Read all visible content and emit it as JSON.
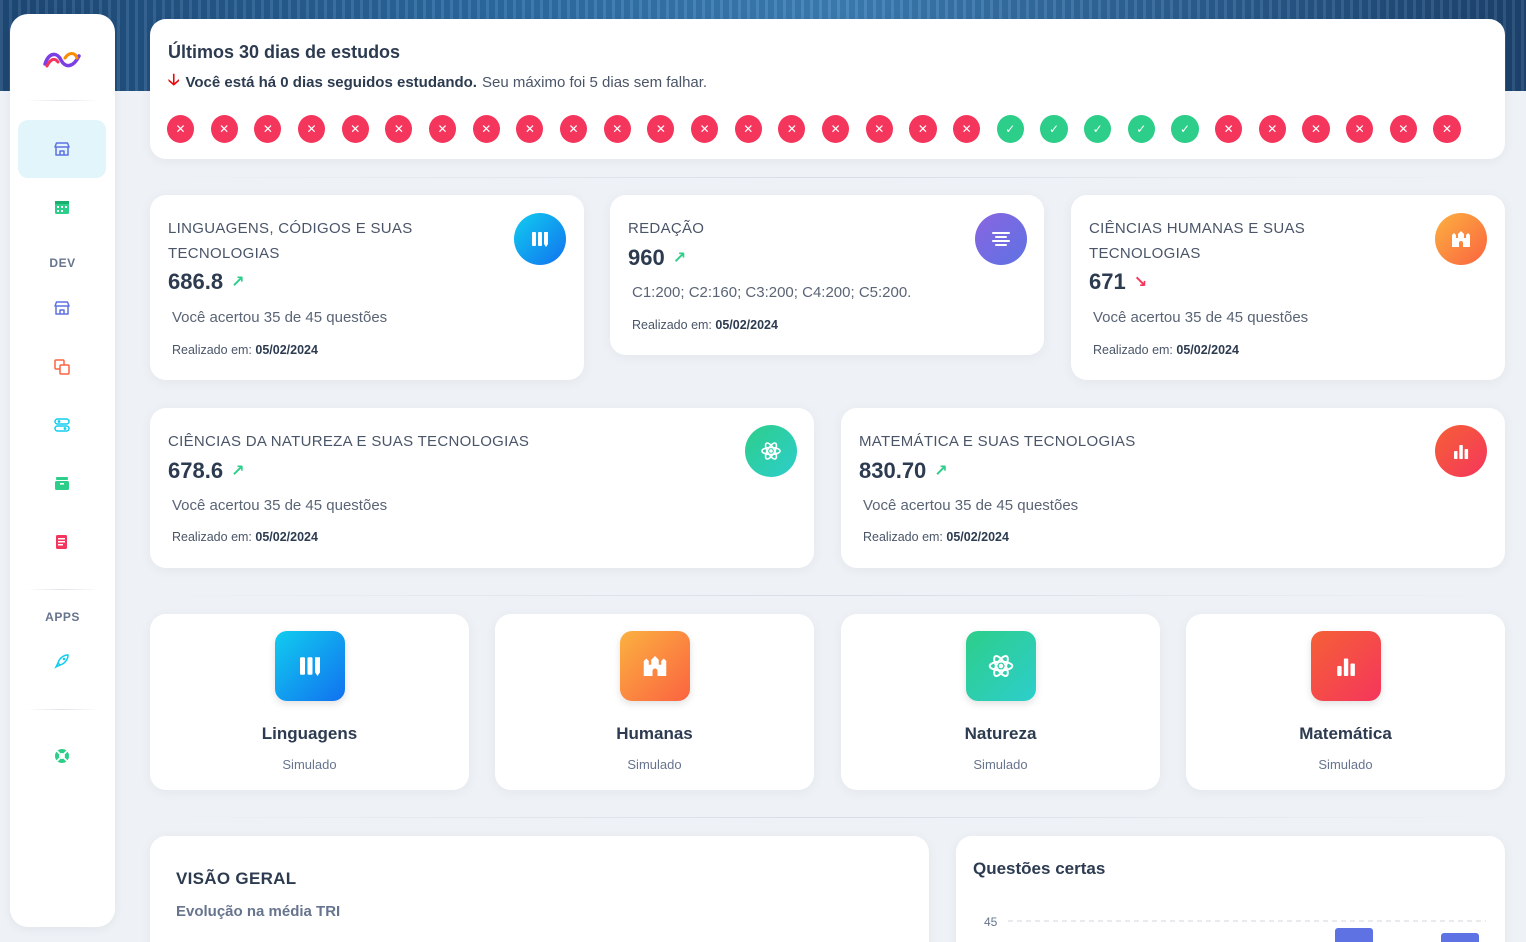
{
  "streak": {
    "title": "Últimos 30 dias de estudos",
    "status_bold": "Você está há 0 dias seguidos estudando.",
    "status_rest": "Seu máximo foi 5 dias sem falhar.",
    "days": [
      "miss",
      "miss",
      "miss",
      "miss",
      "miss",
      "miss",
      "miss",
      "miss",
      "miss",
      "miss",
      "miss",
      "miss",
      "miss",
      "miss",
      "miss",
      "miss",
      "miss",
      "miss",
      "miss",
      "hit",
      "hit",
      "hit",
      "hit",
      "hit",
      "miss",
      "miss",
      "miss",
      "miss",
      "miss",
      "miss"
    ]
  },
  "sidebar": {
    "section_dev": "DEV",
    "section_apps": "APPS"
  },
  "scores": [
    {
      "title": "LINGUAGENS, CÓDIGOS E SUAS TECNOLOGIAS",
      "score": "686.8",
      "trend": "up",
      "detail": "Você acertou 35 de 45 questões",
      "date_label": "Realizado em:",
      "date": "05/02/2024",
      "icon": "books-icon",
      "color": "#1171ef"
    },
    {
      "title": "REDAÇÃO",
      "score": "960",
      "trend": "up",
      "detail": "C1:200; C2:160; C3:200; C4:200; C5:200.",
      "date_label": "Realizado em:",
      "date": "05/02/2024",
      "icon": "text-align-icon",
      "color": "#7764e4"
    },
    {
      "title": "CIÊNCIAS HUMANAS E SUAS TECNOLOGIAS",
      "score": "671",
      "trend": "down",
      "detail": "Você acertou 35 de 45 questões",
      "date_label": "Realizado em:",
      "date": "05/02/2024",
      "icon": "castle-icon",
      "color": "#fb6340"
    },
    {
      "title": "CIÊNCIAS DA NATUREZA E SUAS TECNOLOGIAS",
      "score": "678.6",
      "trend": "up",
      "detail": "Você acertou 35 de 45 questões",
      "date_label": "Realizado em:",
      "date": "05/02/2024",
      "icon": "atom-icon",
      "color": "#2dce89"
    },
    {
      "title": "MATEMÁTICA E SUAS TECNOLOGIAS",
      "score": "830.70",
      "trend": "up",
      "detail": "Você acertou 35 de 45 questões",
      "date_label": "Realizado em:",
      "date": "05/02/2024",
      "icon": "bar-chart-icon",
      "color": "#f5365c"
    }
  ],
  "tiles": [
    {
      "name": "Linguagens",
      "sub": "Simulado",
      "icon": "books-icon"
    },
    {
      "name": "Humanas",
      "sub": "Simulado",
      "icon": "castle-icon"
    },
    {
      "name": "Natureza",
      "sub": "Simulado",
      "icon": "atom-icon"
    },
    {
      "name": "Matemática",
      "sub": "Simulado",
      "icon": "bar-chart-icon"
    }
  ],
  "overview": {
    "title": "VISÃO GERAL",
    "subtitle": "Evolução na média TRI"
  },
  "questions_chart": {
    "title": "Questões certas",
    "y_tick_top": "45"
  }
}
